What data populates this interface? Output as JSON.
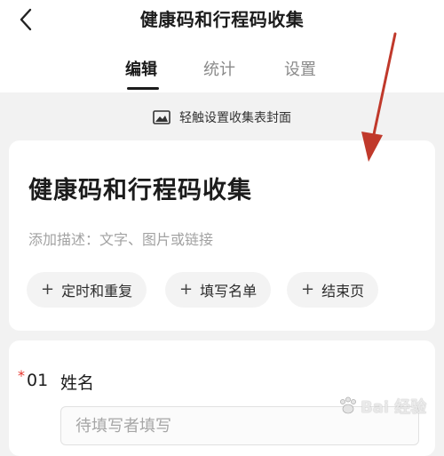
{
  "header": {
    "title": "健康码和行程码收集",
    "tabs": [
      {
        "label": "编辑",
        "active": true
      },
      {
        "label": "统计",
        "active": false
      },
      {
        "label": "设置",
        "active": false
      }
    ]
  },
  "cover": {
    "label": "轻触设置收集表封面",
    "icon": "image-icon"
  },
  "form": {
    "title": "健康码和行程码收集",
    "description_placeholder": "添加描述：文字、图片或链接",
    "actions": [
      {
        "label": "定时和重复"
      },
      {
        "label": "填写名单"
      },
      {
        "label": "结束页"
      }
    ]
  },
  "question": {
    "required_mark": "*",
    "number": "01",
    "label": "姓名",
    "placeholder": "待填写者填写"
  },
  "watermark": {
    "text": "Bai 经验"
  },
  "colors": {
    "accent_red": "#c0392b",
    "required_red": "#e5342b"
  }
}
